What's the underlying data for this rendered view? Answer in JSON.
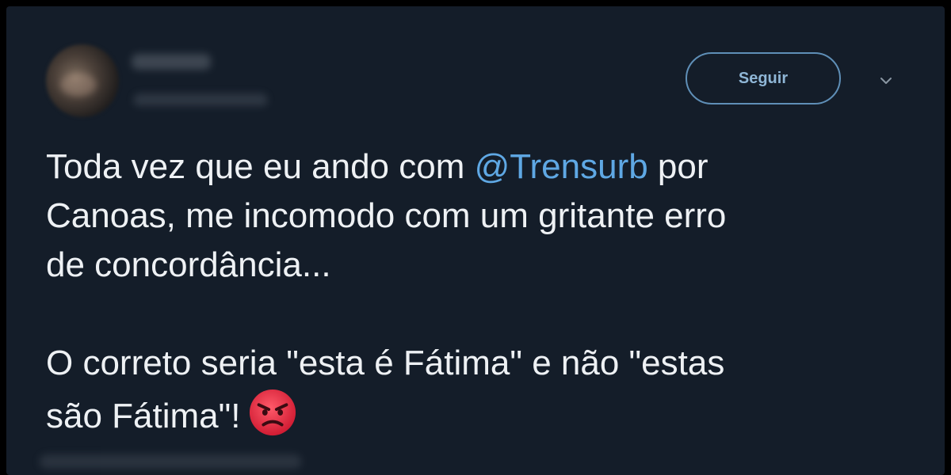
{
  "tweet": {
    "follow_label": "Seguir",
    "paragraph1": {
      "before_mention": "Toda vez que eu ando com ",
      "mention": "@Trensurb",
      "after_mention": " por",
      "line2": "Canoas, me incomodo com um gritante erro",
      "line3": "de concordância..."
    },
    "paragraph2": {
      "line1": "O correto seria \"esta é Fátima\" e não \"estas",
      "line2": "são Fátima\"!"
    },
    "emoji": "angry-face-emoji"
  },
  "icons": {
    "menu": "chevron-down-icon",
    "avatar": "user-avatar"
  },
  "colors": {
    "background": "#141d29",
    "text": "#eef1f4",
    "mention": "#5fa8e4",
    "follow_border": "#5f8fb7",
    "follow_text": "#8fb6d6",
    "emoji": "#e0243d"
  }
}
